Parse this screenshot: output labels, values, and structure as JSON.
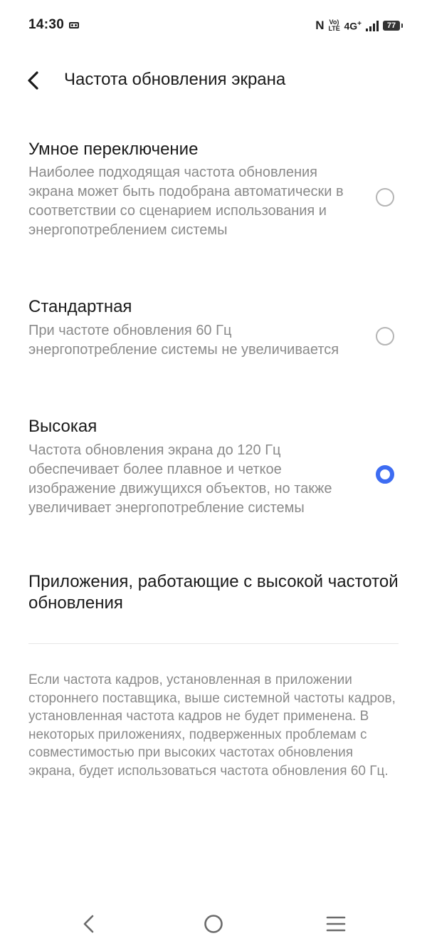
{
  "status_bar": {
    "time": "14:30",
    "nfc": "N",
    "volte_top": "Vo)",
    "volte_bottom": "LTE",
    "network": "4G",
    "network_plus": "+",
    "battery": "77"
  },
  "header": {
    "title": "Частота обновления экрана"
  },
  "options": [
    {
      "title": "Умное переключение",
      "description": "Наиболее подходящая частота обновления экрана может быть подобрана автоматически в соответствии со сценарием использования и энергопотреблением системы",
      "selected": false
    },
    {
      "title": "Стандартная",
      "description": "При частоте обновления 60 Гц энергопотребление системы не увеличивается",
      "selected": false
    },
    {
      "title": "Высокая",
      "description": "Частота обновления экрана до 120 Гц обеспечивает более плавное и четкое изображение движущихся объектов, но также увеличивает энергопотребление системы",
      "selected": true
    }
  ],
  "apps_link": {
    "label": "Приложения, работающие с высокой частотой обновления"
  },
  "footnote": "Если частота кадров, установленная в приложении стороннего поставщика, выше системной частоты кадров, установленная частота кадров не будет применена. В некоторых приложениях, подверженных проблемам с совместимостью при высоких частотах обновления экрана, будет использоваться частота обновления 60 Гц.",
  "colors": {
    "accent": "#3d6cf2",
    "secondary_text": "#8a8a8a",
    "primary_text": "#1a1a1a"
  },
  "nav_bar": {
    "icons": [
      "back-icon",
      "home-icon",
      "menu-icon"
    ]
  }
}
